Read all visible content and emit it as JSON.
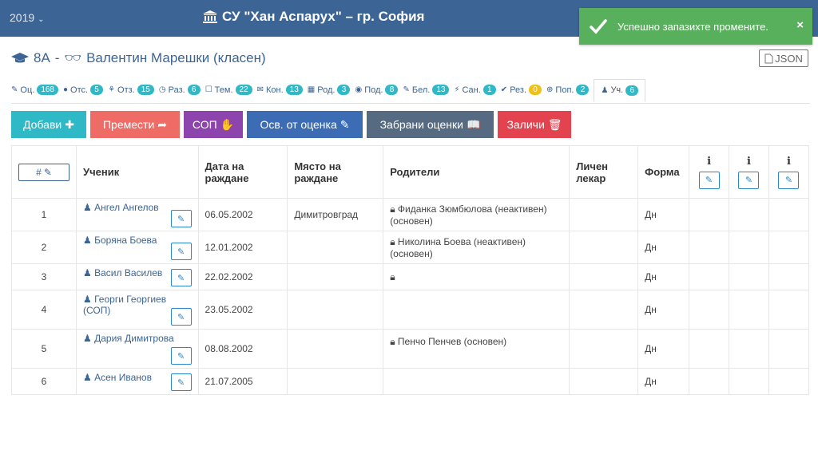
{
  "topbar": {
    "year": "2019",
    "school": "СУ \"Хан Аспарух\" – гр. София"
  },
  "toast": {
    "message": "Успешно запазихте промените.",
    "close": "×"
  },
  "class_title": {
    "class": "8А",
    "separator": "-",
    "teacher": "Валентин Марешки (класен)"
  },
  "json_button": "JSON",
  "tabs": [
    {
      "icon": "✎",
      "label": "Оц.",
      "count": "168"
    },
    {
      "icon": "●",
      "label": "Отс.",
      "count": "5"
    },
    {
      "icon": "⚘",
      "label": "Отз.",
      "count": "15"
    },
    {
      "icon": "◷",
      "label": "Раз.",
      "count": "6"
    },
    {
      "icon": "☐",
      "label": "Тем.",
      "count": "22"
    },
    {
      "icon": "✉",
      "label": "Кон.",
      "count": "13"
    },
    {
      "icon": "▦",
      "label": "Род.",
      "count": "3"
    },
    {
      "icon": "◉",
      "label": "Под.",
      "count": "8"
    },
    {
      "icon": "✎",
      "label": "Бел.",
      "count": "13"
    },
    {
      "icon": "⚡",
      "label": "Сан.",
      "count": "1"
    },
    {
      "icon": "✔",
      "label": "Рез.",
      "count": "0"
    },
    {
      "icon": "⊕",
      "label": "Поп.",
      "count": "2"
    },
    {
      "icon": "♟",
      "label": "Уч.",
      "count": "6"
    }
  ],
  "buttons": [
    {
      "label": "Добави",
      "icon": "✚",
      "color": "#2fb8c6"
    },
    {
      "label": "Премести",
      "icon": "➦",
      "color": "#ee6b66"
    },
    {
      "label": "СОП",
      "icon": "✋",
      "color": "#8e44ad"
    },
    {
      "label": "Осв. от оценка",
      "icon": "✎",
      "color": "#3c6db4"
    },
    {
      "label": "Забрани оценки",
      "icon": "📖",
      "color": "#566a82"
    },
    {
      "label": "Заличи",
      "icon": "🗑",
      "color": "#e3434f"
    }
  ],
  "table": {
    "headers": {
      "hash": "#",
      "student": "Ученик",
      "dob": "Дата на раждане",
      "pob": "Място на раждане",
      "parents": "Родители",
      "doctor": "Личен лекар",
      "form": "Форма",
      "info": "i"
    },
    "rows": [
      {
        "num": "1",
        "name": "Ангел Ангелов",
        "dob": "06.05.2002",
        "pob": "Димитровград",
        "parent": "Фиданка Зюмбюлова (неактивен) (основен)",
        "form": "Дн"
      },
      {
        "num": "2",
        "name": "Боряна Боева",
        "dob": "12.01.2002",
        "pob": "",
        "parent": "Николина Боева (неактивен) (основен)",
        "form": "Дн"
      },
      {
        "num": "3",
        "name": "Васил Василев",
        "dob": "22.02.2002",
        "pob": "",
        "parent": "",
        "form": "Дн"
      },
      {
        "num": "4",
        "name": "Георги Георгиев (СОП)",
        "dob": "23.05.2002",
        "pob": "",
        "parent": "",
        "form": "Дн"
      },
      {
        "num": "5",
        "name": "Дария Димитрова",
        "dob": "08.08.2002",
        "pob": "",
        "parent": "Пенчо Пенчев (основен)",
        "form": "Дн"
      },
      {
        "num": "6",
        "name": "Асен Иванов",
        "dob": "21.07.2005",
        "pob": "",
        "parent": "",
        "form": "Дн"
      }
    ]
  }
}
